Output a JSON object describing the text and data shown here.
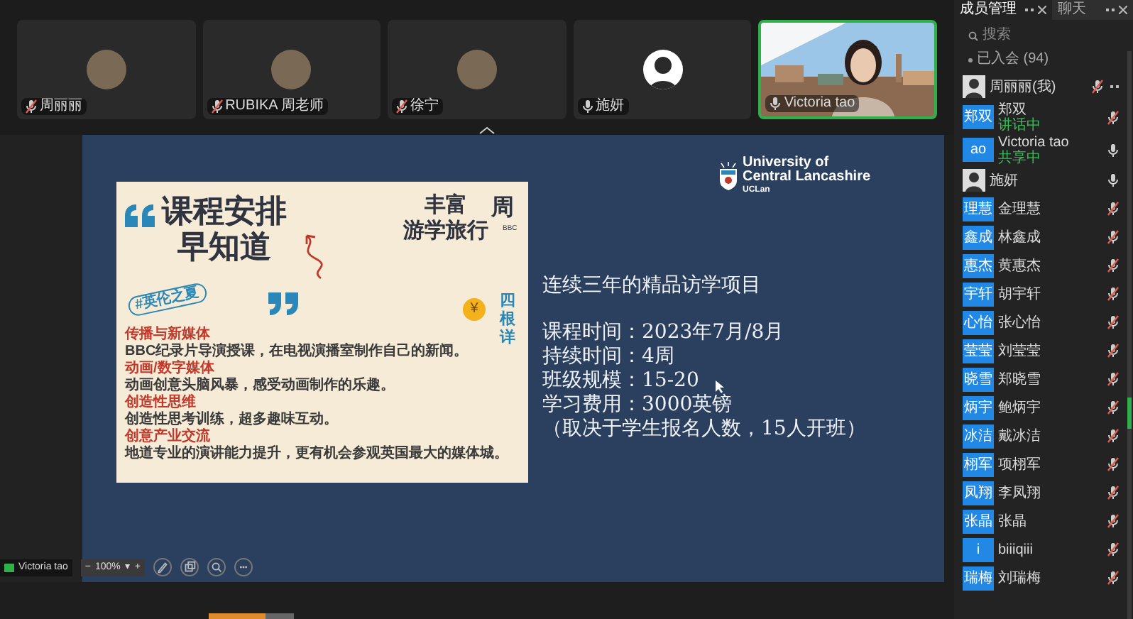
{
  "video_tiles": [
    {
      "name": "周丽丽",
      "kind": "picture",
      "muted": true,
      "selected": false
    },
    {
      "name": "RUBIKA 周老师",
      "kind": "picture",
      "muted": true,
      "selected": false
    },
    {
      "name": "徐宁",
      "kind": "picture",
      "muted": true,
      "selected": false
    },
    {
      "name": "施妍",
      "kind": "person",
      "muted": false,
      "selected": false
    },
    {
      "name": "Victoria tao",
      "kind": "video",
      "muted": false,
      "selected": true
    }
  ],
  "slide": {
    "card": {
      "title_lines": [
        "课程安排",
        "早知道"
      ],
      "tag": "#英伦之夏",
      "side_title_lines": [
        "丰富",
        "游学旅行"
      ],
      "side_cut": "周",
      "side_small": "BBC",
      "coin": "¥",
      "side_cut_lines": [
        "四",
        "根",
        "详"
      ],
      "sections": [
        {
          "heading": "传播与新媒体",
          "body": "BBC纪录片导演授课，在电视演播室制作自己的新闻。"
        },
        {
          "heading": "动画/数字媒体",
          "body": "动画创意头脑风暴，感受动画制作的乐趣。"
        },
        {
          "heading": "创造性思维",
          "body": "创造性思考训练，超多趣味互动。"
        },
        {
          "heading": "创意产业交流",
          "body": "地道专业的演讲能力提升，更有机会参观英国最大的媒体城。"
        }
      ]
    },
    "logo_lines": [
      "University of",
      "Central Lancashire",
      "UCLan"
    ],
    "heading": "连续三年的精品访学项目",
    "lines": [
      "课程时间：2023年7月/8月",
      "持续时间：4周",
      "班级规模：15-20",
      "学习费用：3000英镑",
      "（取决于学生报名人数，15人开班）"
    ]
  },
  "sharer": {
    "name": "Victoria tao"
  },
  "zoom": {
    "minus": "−",
    "value": "100%",
    "caret": "▾",
    "plus": "+"
  },
  "panel": {
    "tabs": [
      {
        "label": "成员管理",
        "selected": true
      },
      {
        "label": "聊天",
        "selected": false
      }
    ],
    "search": {
      "placeholder": "搜索"
    },
    "group": "已入会 (94)",
    "members": [
      {
        "name": "周丽丽(我)",
        "kind": "picture",
        "muted": true,
        "more": true
      },
      {
        "name": "郑双",
        "kind": "text",
        "avatar": "郑双",
        "status": "讲话中",
        "muted": true
      },
      {
        "name": "Victoria tao",
        "kind": "text",
        "avatar": "ao",
        "status": "共享中",
        "muted": false
      },
      {
        "name": "施妍",
        "kind": "picture",
        "muted": false
      },
      {
        "name": "金理慧",
        "kind": "text",
        "avatar": "理慧",
        "muted": true
      },
      {
        "name": "林鑫成",
        "kind": "text",
        "avatar": "鑫成",
        "muted": true
      },
      {
        "name": "黄惠杰",
        "kind": "text",
        "avatar": "惠杰",
        "muted": true
      },
      {
        "name": "胡宇轩",
        "kind": "text",
        "avatar": "宇轩",
        "muted": true
      },
      {
        "name": "张心怡",
        "kind": "text",
        "avatar": "心怡",
        "muted": true
      },
      {
        "name": "刘莹莹",
        "kind": "text",
        "avatar": "莹莹",
        "muted": true
      },
      {
        "name": "郑晓雪",
        "kind": "text",
        "avatar": "晓雪",
        "muted": true
      },
      {
        "name": "鲍炳宇",
        "kind": "text",
        "avatar": "炳宇",
        "muted": true
      },
      {
        "name": "戴冰洁",
        "kind": "text",
        "avatar": "冰洁",
        "muted": true
      },
      {
        "name": "项栩军",
        "kind": "text",
        "avatar": "栩军",
        "muted": true
      },
      {
        "name": "李凤翔",
        "kind": "text",
        "avatar": "凤翔",
        "muted": true
      },
      {
        "name": "张晶",
        "kind": "text",
        "avatar": "张晶",
        "muted": true
      },
      {
        "name": "biiiqiii",
        "kind": "text",
        "avatar": "i",
        "muted": true
      },
      {
        "name": "刘瑞梅",
        "kind": "text",
        "avatar": "瑞梅",
        "muted": true
      }
    ]
  }
}
